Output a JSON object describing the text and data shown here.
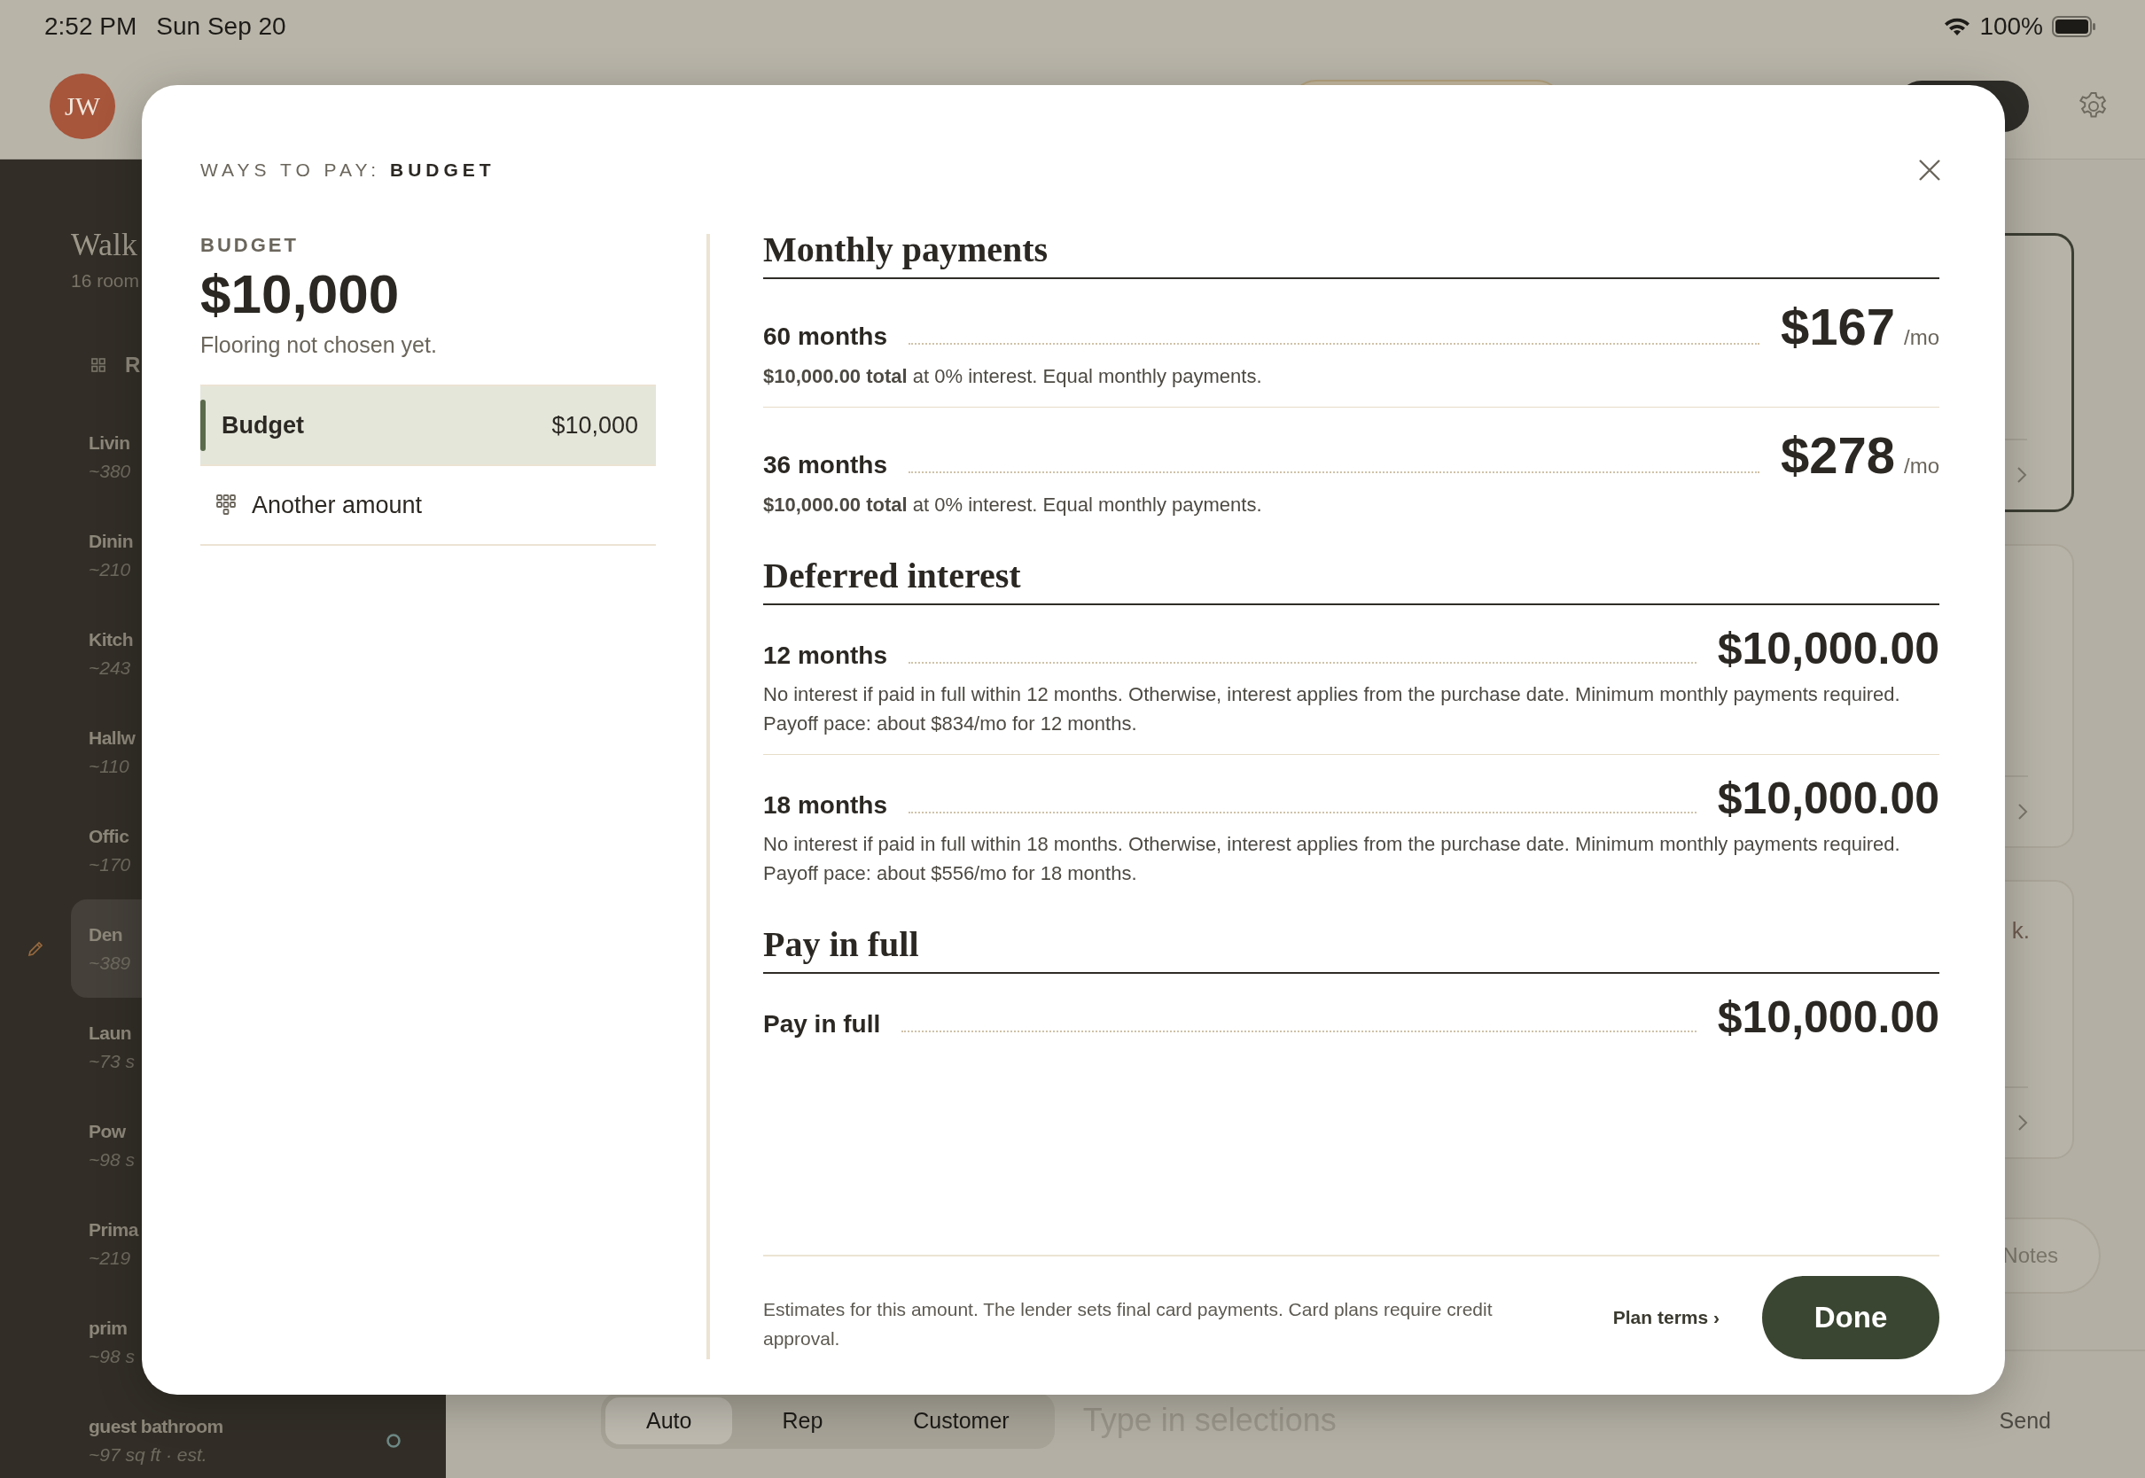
{
  "status_bar": {
    "time": "2:52 PM",
    "date": "Sun Sep 20",
    "battery": "100%"
  },
  "header": {
    "avatar": "JW"
  },
  "sidebar": {
    "title": "Walk",
    "subtitle": "16 room",
    "section": "R",
    "rooms": [
      {
        "name": "Livin",
        "area": "~380",
        "selected": false
      },
      {
        "name": "Dinin",
        "area": "~210",
        "selected": false
      },
      {
        "name": "Kitch",
        "area": "~243",
        "selected": false
      },
      {
        "name": "Hallw",
        "area": "~110",
        "selected": false
      },
      {
        "name": "Offic",
        "area": "~170",
        "selected": false
      },
      {
        "name": "Den",
        "area": "~389",
        "selected": true
      },
      {
        "name": "Laun",
        "area": "~73 s",
        "selected": false
      },
      {
        "name": "Pow",
        "area": "~98 s",
        "selected": false
      },
      {
        "name": "Prima",
        "area": "~219",
        "selected": false
      },
      {
        "name": "prim",
        "area": "~98 s",
        "selected": false
      },
      {
        "name": "guest bathroom",
        "area": "~97 sq ft · est.",
        "selected": false,
        "pending": true
      }
    ]
  },
  "cards": [
    {
      "selected": true
    },
    {
      "selected": false
    },
    {
      "selected": false,
      "text": "k."
    }
  ],
  "notes_button": "Notes",
  "composer": {
    "modes": [
      {
        "label": "Auto",
        "selected": true
      },
      {
        "label": "Rep",
        "selected": false
      },
      {
        "label": "Customer",
        "selected": false
      }
    ],
    "placeholder": "Type in selections",
    "send": "Send"
  },
  "modal": {
    "title": "WAYS TO PAY: **BUDGET**",
    "summary": {
      "label": "BUDGET",
      "amount": "$10,000",
      "note": "Flooring not chosen yet."
    },
    "options": [
      {
        "kind": "preset",
        "label": "Budget",
        "amount": "$10,000",
        "selected": true
      },
      {
        "kind": "custom",
        "label": "Another amount",
        "selected": false
      }
    ],
    "sections": [
      {
        "heading": "Monthly payments",
        "plans": [
          {
            "kind": "monthly",
            "term": "60 months",
            "amount": "$167",
            "unit": "/mo",
            "note": "**$10,000.00 total** at 0% interest. Equal monthly payments."
          },
          {
            "kind": "monthly",
            "term": "36 months",
            "amount": "$278",
            "unit": "/mo",
            "note": "**$10,000.00 total** at 0% interest. Equal monthly payments."
          }
        ]
      },
      {
        "heading": "Deferred interest",
        "plans": [
          {
            "kind": "total",
            "term": "12 months",
            "amount": "$10,000.00",
            "note": "No interest if paid in full within 12 months. Otherwise, interest applies from the purchase date. Minimum monthly payments required. Payoff pace: about $834/mo for 12 months."
          },
          {
            "kind": "total",
            "term": "18 months",
            "amount": "$10,000.00",
            "note": "No interest if paid in full within 18 months. Otherwise, interest applies from the purchase date. Minimum monthly payments required. Payoff pace: about $556/mo for 18 months."
          }
        ]
      },
      {
        "heading": "Pay in full",
        "plans": [
          {
            "kind": "total",
            "term": "Pay in full",
            "amount": "$10,000.00"
          }
        ]
      }
    ],
    "footer": {
      "disclaimer": "Estimates for this amount. The lender sets final card payments. Card plans require credit approval.",
      "link": "Plan terms ›",
      "done": "Done"
    }
  }
}
